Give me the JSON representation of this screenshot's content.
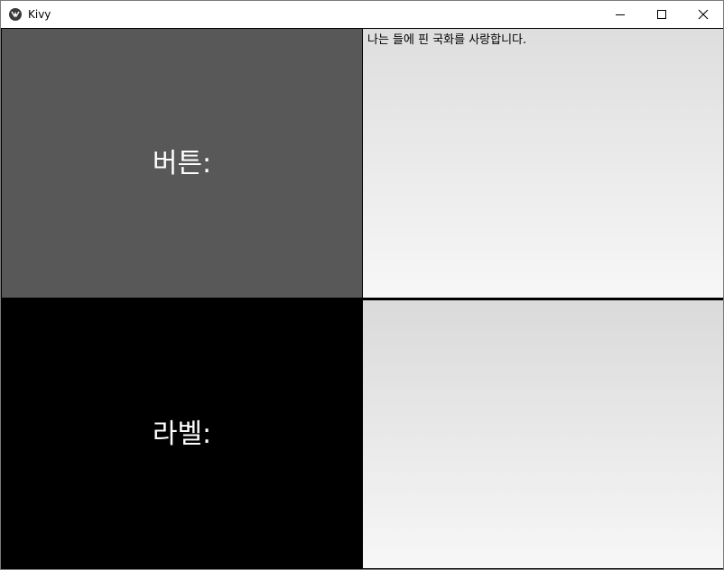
{
  "window": {
    "title": "Kivy",
    "app_icon": "kivy-logo-icon",
    "controls": {
      "minimize_icon": "minimize-icon",
      "maximize_icon": "maximize-icon",
      "close_icon": "close-icon"
    }
  },
  "grid": {
    "button_cell": {
      "label": "버튼:",
      "background": "#585858"
    },
    "label_cell": {
      "label": "라벨:",
      "background": "#000000"
    },
    "text_input_1": {
      "value": "나는 들에 핀 국화를 사랑합니다."
    },
    "text_input_2": {
      "value": ""
    }
  }
}
